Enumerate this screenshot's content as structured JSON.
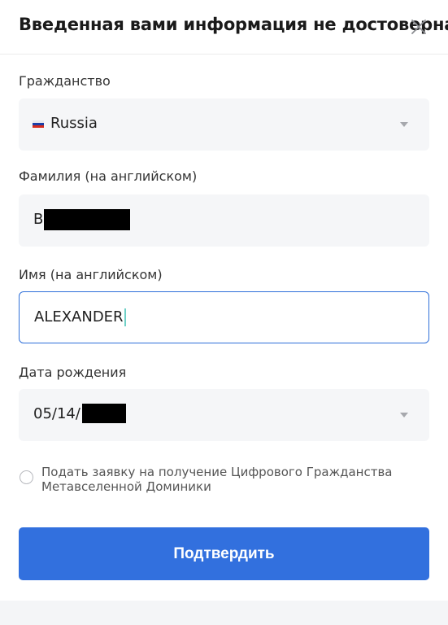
{
  "dialog": {
    "title": "Введенная вами информация не достоверна",
    "close_icon": "close-icon"
  },
  "form": {
    "citizenship": {
      "label": "Гражданство",
      "value": "Russia",
      "flag_icon": "russia-flag-icon",
      "flag_colors": [
        "#ffffff",
        "#1c3fa8",
        "#d52b1e"
      ]
    },
    "last_name": {
      "label": "Фамилия (на английском)",
      "value": "B"
    },
    "first_name": {
      "label": "Имя (на английском)",
      "value": "ALEXANDER"
    },
    "birth_date": {
      "label": "Дата рождения",
      "value": "05/14/"
    }
  },
  "consent": {
    "label": "Подать заявку на получение Цифрового Гражданства Метавселенной Доминики",
    "checked": false
  },
  "submit": {
    "label": "Подтвердить"
  },
  "colors": {
    "accent": "#3270de",
    "field_bg": "#f5f6f8",
    "active_border": "#2f6fd9",
    "caret": "#6fd0c7"
  }
}
